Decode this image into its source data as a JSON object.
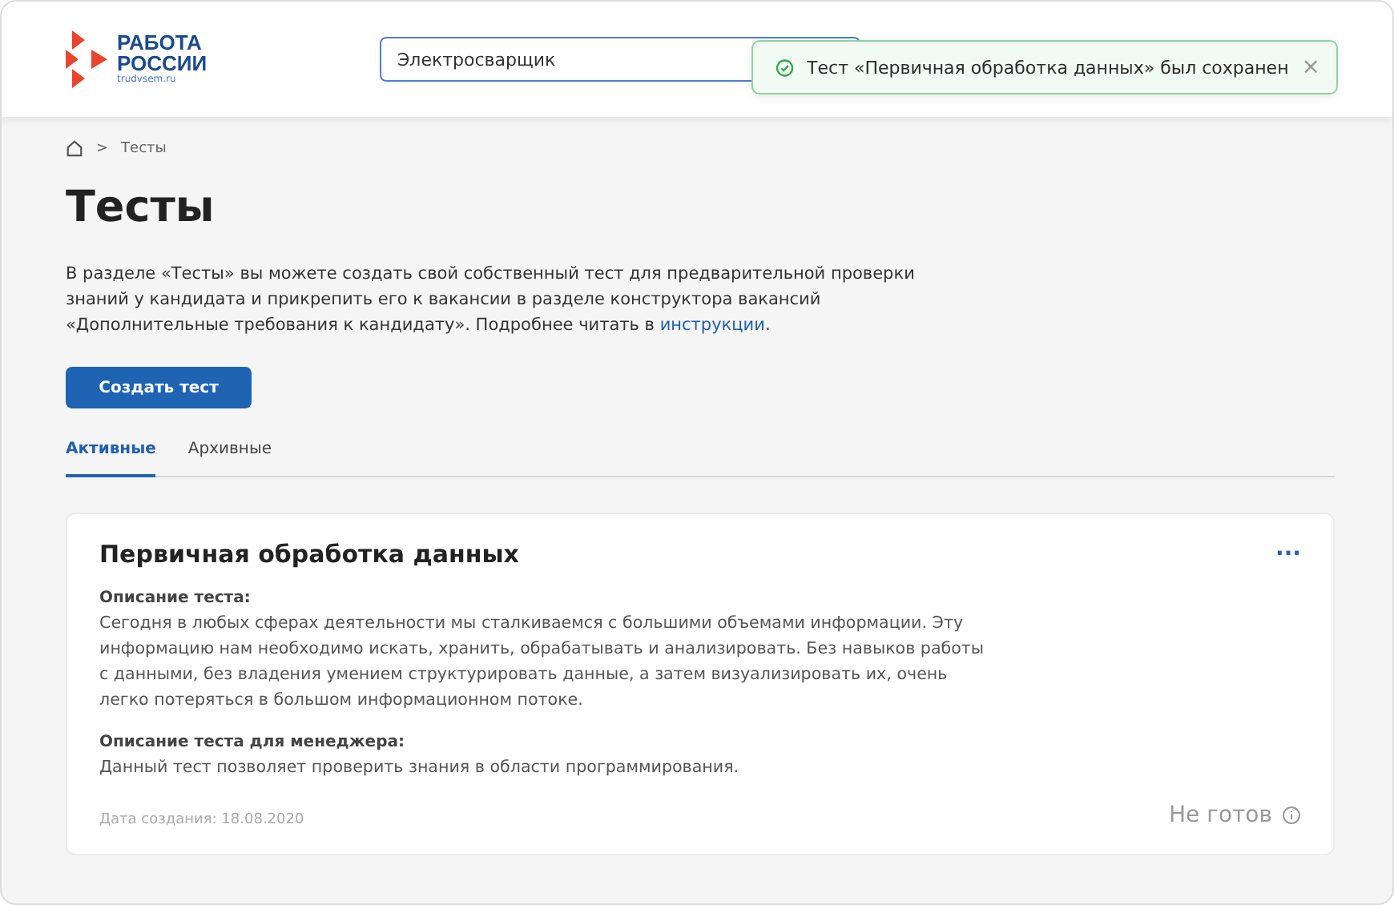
{
  "header": {
    "logo": {
      "line1": "РАБОТА",
      "line2": "РОССИИ",
      "site": "trudvsem.ru"
    },
    "search": {
      "value": "Электросварщик"
    }
  },
  "toast": {
    "text": "Тест «Первичная обработка данных» был сохранен",
    "close": "×"
  },
  "breadcrumbs": {
    "separator": ">",
    "current": "Тесты"
  },
  "title": "Тесты",
  "intro": {
    "text": "В разделе «Тесты» вы можете создать свой собственный тест для предварительной проверки знаний у кандидата и прикрепить его к вакансии в разделе конструктора вакансий «Дополнительные требования к кандидату». Подробнее читать в",
    "link": "инструкции",
    "end": "."
  },
  "create_button": "Создать тест",
  "tabs": [
    {
      "label": "Активные",
      "selected": true
    },
    {
      "label": "Архивные",
      "selected": false
    }
  ],
  "tests": [
    {
      "title": "Первичная обработка данных",
      "menu": "···",
      "sections": [
        {
          "heading": "Описание теста:",
          "text": "Сегодня в любых сферах деятельности мы сталкиваемся с большими объемами информации. Эту информацию нам необходимо искать, хранить, обрабатывать и анализировать. Без навыков работы с данными, без владения умением структурировать данные, а затем визуализировать их, очень легко потеряться в большом информационном потоке."
        },
        {
          "heading": "Описание теста для менеджера:",
          "text": "Данный тест позволяет проверить знания в области программирования."
        }
      ],
      "date": "Дата создания: 18.08.2020",
      "status": "Не готов"
    }
  ]
}
